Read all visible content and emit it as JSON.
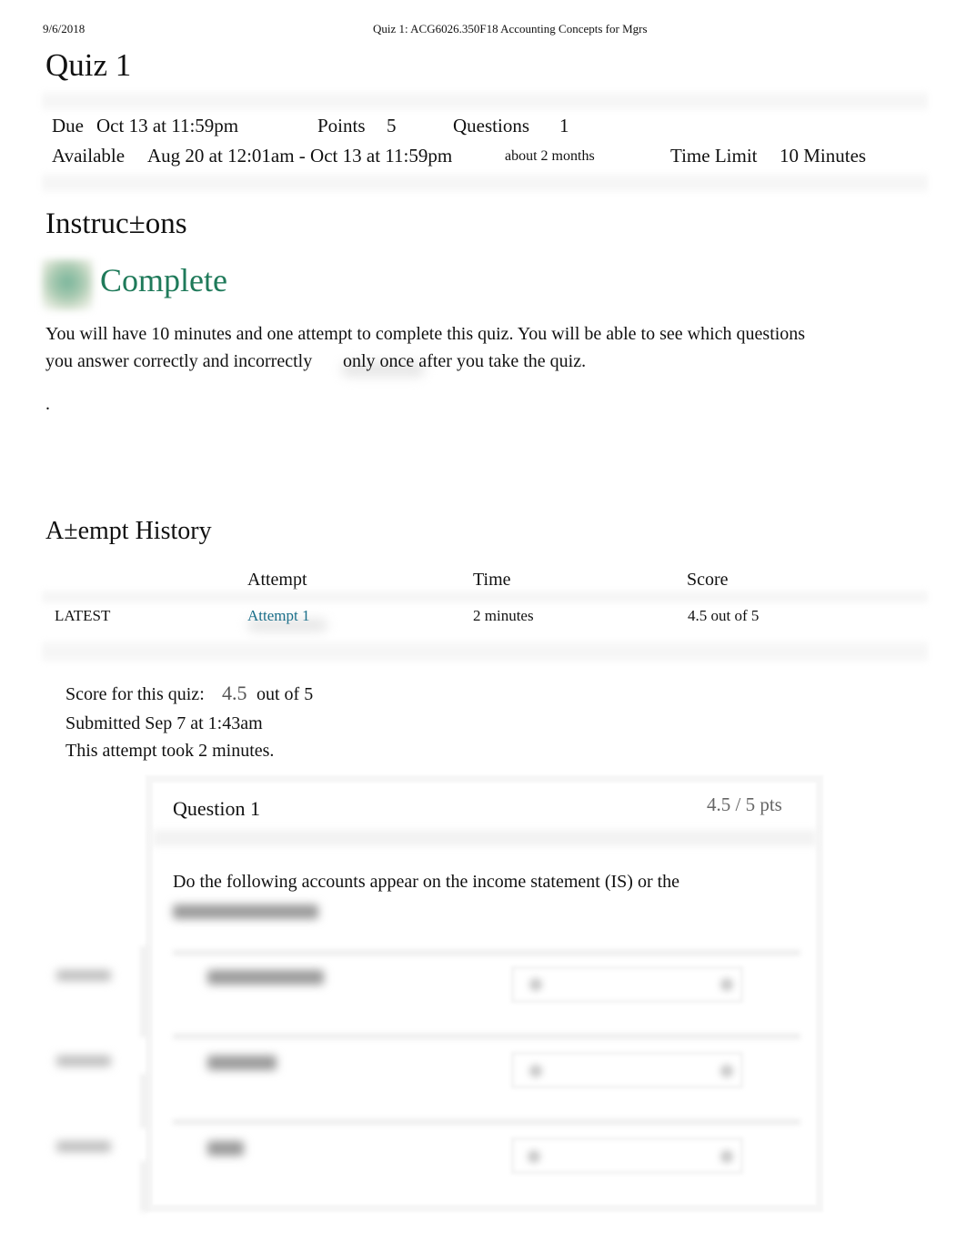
{
  "print_header": {
    "date": "9/6/2018",
    "title": "Quiz 1: ACG6026.350F18 Accounting Concepts for Mgrs"
  },
  "page_title": "Quiz 1",
  "details": {
    "due_label": "Due",
    "due_value": "Oct 13 at 11:59pm",
    "points_label": "Points",
    "points_value": "5",
    "questions_label": "Questions",
    "questions_value": "1",
    "available_label": "Available",
    "available_value": "Aug 20 at 12:01am - Oct 13 at 11:59pm",
    "available_duration": "about 2 months",
    "time_limit_label": "Time Limit",
    "time_limit_value": "10 Minutes"
  },
  "instructions": {
    "heading": "Instruc±ons",
    "status_icon": "complete-checkmark-icon",
    "status_label": "Complete",
    "status_color": "#1f7a5a",
    "line1": "You will have 10 minutes and one attempt to complete this quiz. You will be able to see which questions",
    "line2a": "you answer correctly and incorrectly",
    "line2b": "only once after you take the quiz.",
    "trailing": "."
  },
  "attempt_history": {
    "heading": "A±empt History",
    "columns": [
      "",
      "Attempt",
      "Time",
      "Score"
    ],
    "rows": [
      {
        "tag": "LATEST",
        "attempt": "Attempt 1",
        "time": "2 minutes",
        "score": "4.5 out of 5"
      }
    ],
    "link_color": "#1b6f8a"
  },
  "summary": {
    "score_label": "Score for this quiz:",
    "score_value": "4.5",
    "score_total": "out of 5",
    "submitted": "Submitted Sep 7 at 1:43am",
    "duration": "This attempt took 2 minutes."
  },
  "question": {
    "title": "Question 1",
    "points": "4.5 / 5 pts",
    "prompt": "Do the following accounts appear on the income statement (IS) or the",
    "blurred_rows": 3
  }
}
